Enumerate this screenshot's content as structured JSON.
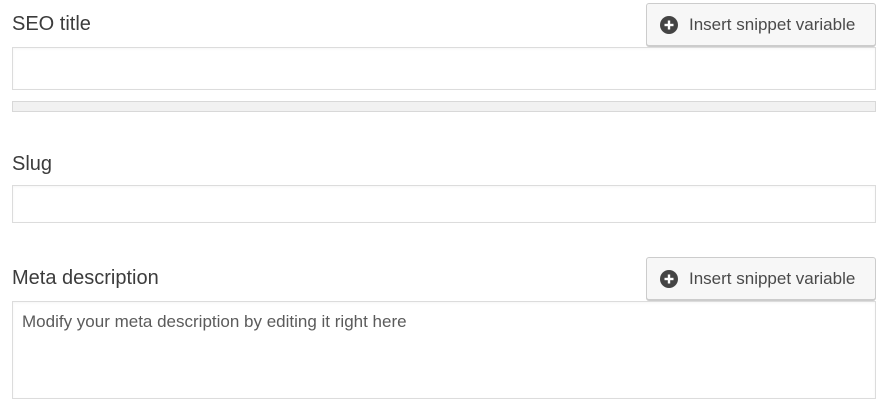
{
  "seo_title": {
    "label": "SEO title",
    "value": "",
    "snippet_button": {
      "label": "Insert snippet variable",
      "icon": "plus-circle-icon"
    },
    "progress_fraction": 0
  },
  "slug": {
    "label": "Slug",
    "value": ""
  },
  "meta_description": {
    "label": "Meta description",
    "placeholder": "Modify your meta description by editing it right here",
    "snippet_button": {
      "label": "Insert snippet variable",
      "icon": "plus-circle-icon"
    }
  },
  "colors": {
    "button_bg": "#f7f7f7",
    "border": "#dcdcdc",
    "text": "#3c3c3c",
    "icon": "#444444"
  }
}
